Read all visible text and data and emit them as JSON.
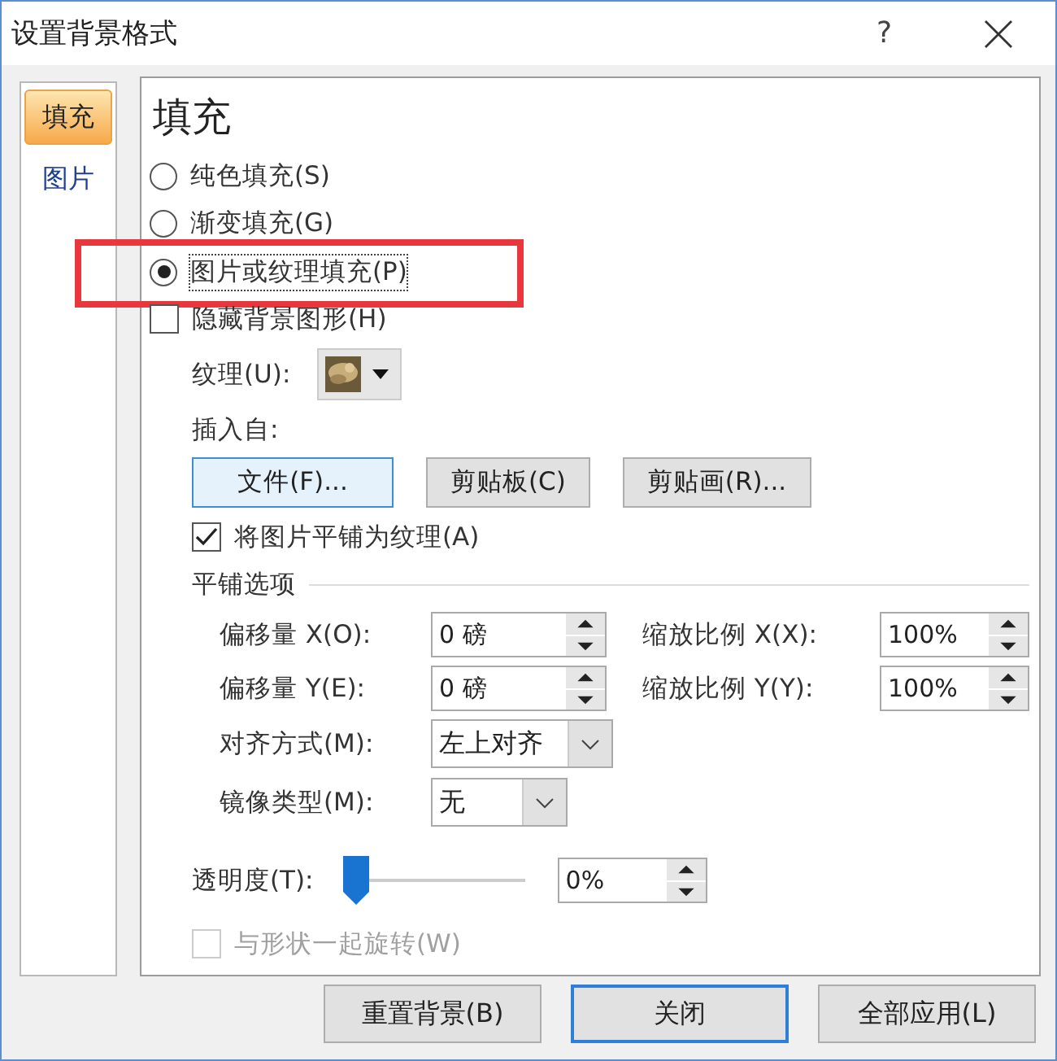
{
  "window": {
    "title": "设置背景格式",
    "help": "?"
  },
  "sidebar": {
    "items": [
      {
        "label": "填充",
        "selected": true
      },
      {
        "label": "图片",
        "selected": false
      }
    ]
  },
  "panel": {
    "heading": "填充",
    "fill_options": [
      {
        "label": "纯色填充(S)",
        "selected": false,
        "highlighted": false
      },
      {
        "label": "渐变填充(G)",
        "selected": false,
        "highlighted": false
      },
      {
        "label": "图片或纹理填充(P)",
        "selected": true,
        "highlighted": true
      }
    ],
    "hide_background": {
      "label": "隐藏背景图形(H)",
      "checked": false
    },
    "texture": {
      "label": "纹理(U):"
    },
    "insert_from": {
      "label": "插入自:",
      "buttons": [
        {
          "label": "文件(F)...",
          "focused": true
        },
        {
          "label": "剪贴板(C)",
          "focused": false
        },
        {
          "label": "剪贴画(R)...",
          "focused": false
        }
      ]
    },
    "tile": {
      "label": "将图片平铺为纹理(A)",
      "checked": true
    },
    "tiling_options": {
      "heading": "平铺选项",
      "spinners": [
        {
          "label": "偏移量 X(O):",
          "value": "0 磅"
        },
        {
          "label": "缩放比例 X(X):",
          "value": "100%"
        },
        {
          "label": "偏移量 Y(E):",
          "value": "0 磅"
        },
        {
          "label": "缩放比例 Y(Y):",
          "value": "100%"
        }
      ],
      "alignment": {
        "label": "对齐方式(M):",
        "value": "左上对齐"
      },
      "mirror": {
        "label": "镜像类型(M):",
        "value": "无"
      }
    },
    "transparency": {
      "label": "透明度(T):",
      "level": 0,
      "value": "0%"
    },
    "rotate_with_shape": {
      "label": "与形状一起旋转(W)",
      "checked": false,
      "disabled": true
    }
  },
  "buttons": [
    {
      "label": "重置背景(B)",
      "default": false
    },
    {
      "label": "关闭",
      "default": true
    },
    {
      "label": "全部应用(L)",
      "default": false
    }
  ]
}
